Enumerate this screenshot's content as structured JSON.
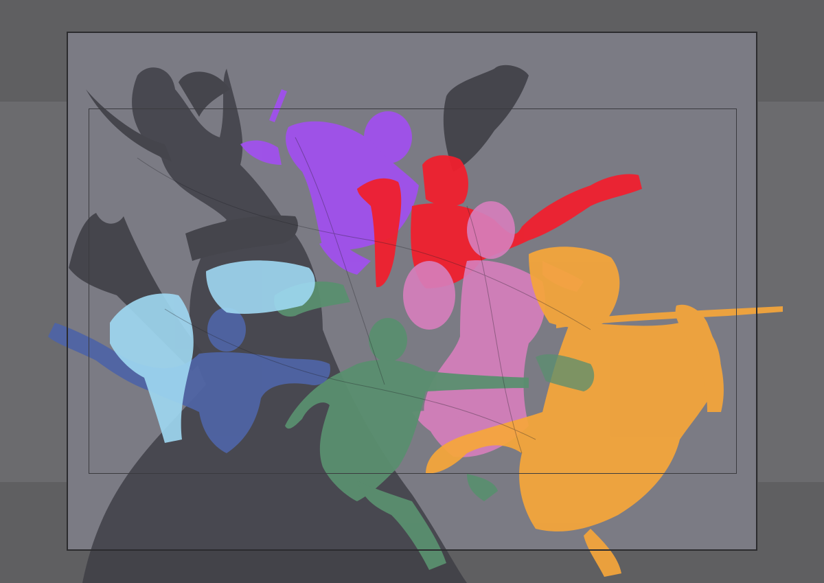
{
  "colors": {
    "background": "#5f5f61",
    "wing_fill": "#6b6b6e",
    "canvas_fill": "#7b7b84",
    "frame_stroke": "#2b2b2e",
    "figure_shadow": "#3c3c43",
    "figure_purple": "#a14ff0",
    "figure_red": "#f0202e",
    "figure_pink": "#d77fbd",
    "figure_orange": "#f6a63a",
    "figure_green": "#5a8f6f",
    "figure_blue": "#4f64a4",
    "figure_lightblue": "#9fd8f2"
  },
  "figures": [
    {
      "name": "horned-dark-figure",
      "color": "figure_shadow"
    },
    {
      "name": "purple-figure",
      "color": "figure_purple"
    },
    {
      "name": "red-figure",
      "color": "figure_red"
    },
    {
      "name": "pink-figure",
      "color": "figure_pink"
    },
    {
      "name": "orange-figure",
      "color": "figure_orange"
    },
    {
      "name": "green-figure",
      "color": "figure_green"
    },
    {
      "name": "blue-figure",
      "color": "figure_blue"
    },
    {
      "name": "light-blue-figure",
      "color": "figure_lightblue"
    }
  ]
}
